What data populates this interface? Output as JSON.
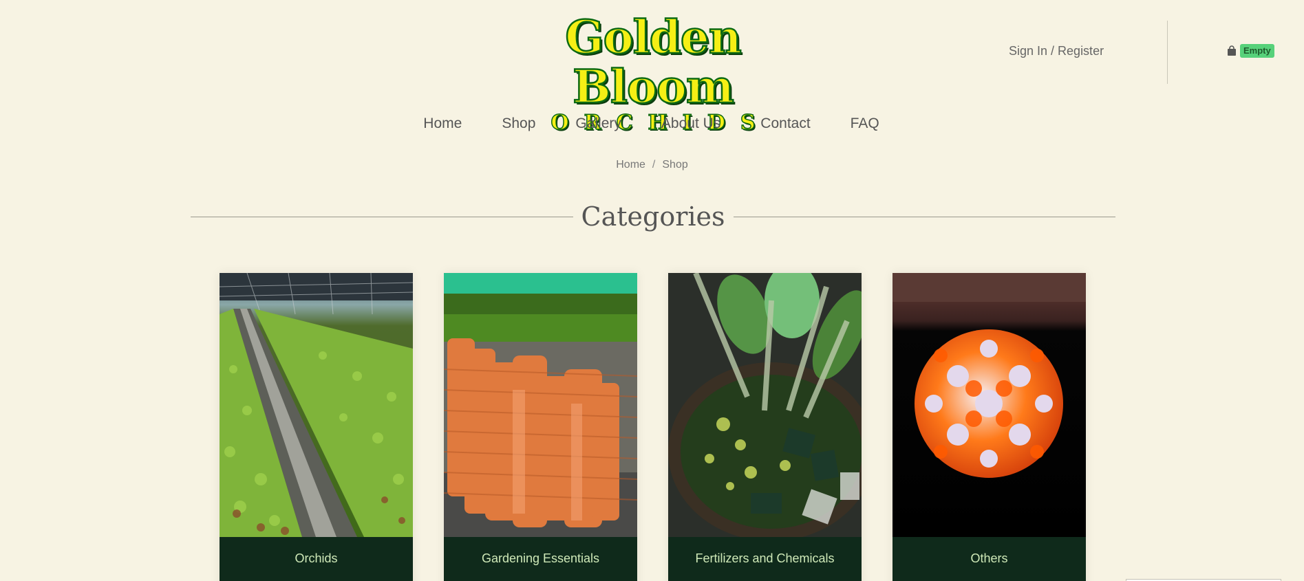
{
  "header": {
    "logo_title": "Golden Bloom",
    "logo_subtitle": "ORCHIDS",
    "signin_label": "Sign In / Register",
    "cart_badge": "Empty",
    "cart_icon": "shopping-bag-icon"
  },
  "nav": {
    "items": [
      "Home",
      "Shop",
      "Gallery",
      "About Us",
      "Contact",
      "FAQ"
    ]
  },
  "breadcrumb": {
    "items": [
      "Home",
      "Shop"
    ],
    "separator": "/"
  },
  "section": {
    "title": "Categories"
  },
  "categories": [
    {
      "label": "Orchids"
    },
    {
      "label": "Gardening Essentials"
    },
    {
      "label": "Fertilizers and Chemicals"
    },
    {
      "label": "Others"
    }
  ],
  "colors": {
    "background": "#f7f3e3",
    "card_footer": "#0f2a1b",
    "card_label": "#cfe9b8",
    "logo_fill": "#f5ef15",
    "logo_stroke": "#0c6a12",
    "badge": "#57d17a"
  }
}
